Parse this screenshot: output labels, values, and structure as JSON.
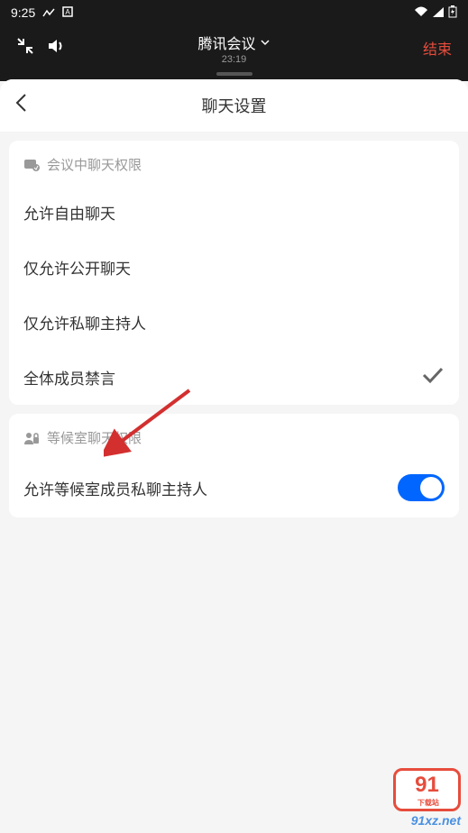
{
  "status_bar": {
    "time": "9:25"
  },
  "meeting_bar": {
    "title": "腾讯会议",
    "duration": "23:19",
    "end_label": "结束"
  },
  "page": {
    "title": "聊天设置"
  },
  "section1": {
    "header": "会议中聊天权限",
    "options": [
      {
        "label": "允许自由聊天",
        "selected": false
      },
      {
        "label": "仅允许公开聊天",
        "selected": false
      },
      {
        "label": "仅允许私聊主持人",
        "selected": false
      },
      {
        "label": "全体成员禁言",
        "selected": true
      }
    ]
  },
  "section2": {
    "header": "等候室聊天权限",
    "option_label": "允许等候室成员私聊主持人",
    "toggle_on": true
  },
  "watermark": {
    "logo_text": "91",
    "logo_sub": "下载站",
    "url": "91xz.net"
  }
}
